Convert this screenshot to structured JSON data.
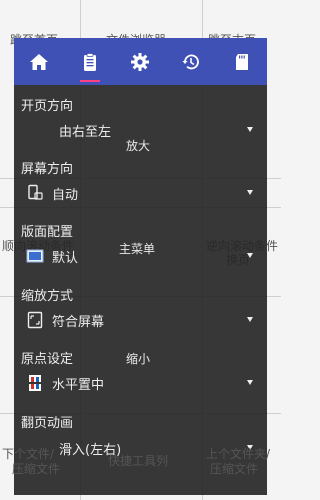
{
  "zones": {
    "top_left": "跳至首页",
    "top_center": "文件浏览器",
    "top_right": "跳至末页",
    "mid_left": "顺向滚动条件",
    "mid_right": "逆向滚动条件",
    "mid_right_2": "换页",
    "center_top": "放大",
    "center": "主菜单",
    "center_bottom": "缩小",
    "bottom_left": "下个文件/",
    "bottom_left_2": "压缩文件",
    "bottom_center": "快捷工具列",
    "bottom_right": "上个文件夹/",
    "bottom_right_2": "压缩文件"
  },
  "tabs": [
    {
      "icon": "home-icon"
    },
    {
      "icon": "clipboard-icon"
    },
    {
      "icon": "gear-icon"
    },
    {
      "icon": "history-icon"
    },
    {
      "icon": "sd-card-icon"
    }
  ],
  "settings": {
    "page_direction": {
      "label": "开页方向",
      "value": "由右至左"
    },
    "screen_orientation": {
      "label": "屏幕方向",
      "value": "自动"
    },
    "layout": {
      "label": "版面配置",
      "value": "默认"
    },
    "zoom_mode": {
      "label": "缩放方式",
      "value": "符合屏幕"
    },
    "origin": {
      "label": "原点设定",
      "value": "水平置中"
    },
    "page_animation": {
      "label": "翻页动画",
      "value": "滑入(左右)"
    }
  },
  "colors": {
    "tabbar": "#3f51b5",
    "tab_indicator": "#ff4081",
    "dialog_bg": "#262626"
  }
}
